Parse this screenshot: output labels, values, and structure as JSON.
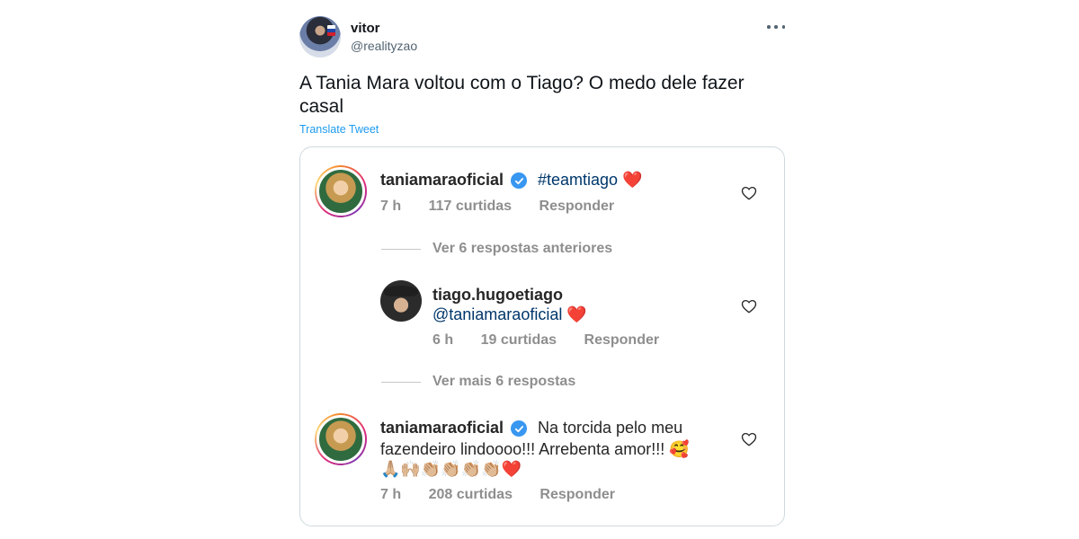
{
  "tweet": {
    "display_name": "vitor",
    "handle": "@realityzao",
    "text": "A Tania Mara voltou com o Tiago? O medo dele fazer casal",
    "translate_label": "Translate Tweet",
    "more_icon": "more-icon"
  },
  "comments": [
    {
      "username": "taniamaraoficial",
      "verified": true,
      "text": "#teamtiago",
      "emoji": "❤️",
      "time": "7 h",
      "likes": "117 curtidas",
      "reply": "Responder"
    },
    {
      "view_more": "Ver 6 respostas anteriores"
    },
    {
      "username": "tiago.hugoetiago",
      "verified": false,
      "mention": "@taniamaraoficial",
      "emoji": "❤️",
      "time": "6 h",
      "likes": "19 curtidas",
      "reply": "Responder"
    },
    {
      "view_more": "Ver mais 6 respostas"
    },
    {
      "username": "taniamaraoficial",
      "verified": true,
      "text_line1": "Na torcida pelo meu",
      "text_line2": "fazendeiro lindoooo!!! Arrebenta amor!!! 🥰",
      "emoji_line": "🙏🏼🙌🏼👏🏼👏🏼👏🏼👏🏼❤️",
      "time": "7 h",
      "likes": "208 curtidas",
      "reply": "Responder"
    }
  ],
  "colors": {
    "link_blue": "#1d9bf0",
    "ig_gray": "#8e8e8e",
    "ig_text": "#262626",
    "verified_blue": "#3897f0"
  }
}
